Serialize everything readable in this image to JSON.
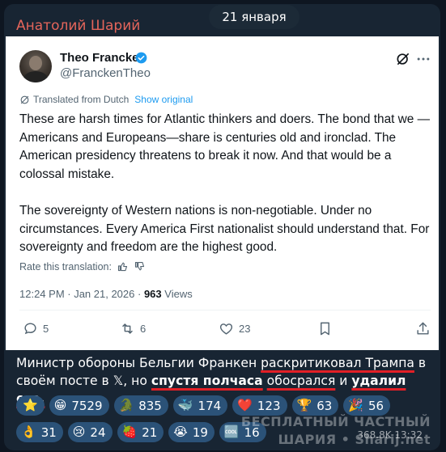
{
  "channel": {
    "sender_name": "Анатолий Шарий",
    "date": "21 января"
  },
  "tweet": {
    "author_name": "Theo Francken",
    "handle": "@FranckenTheo",
    "translated_from": "Translated from Dutch",
    "show_original": "Show original",
    "paragraphs": [
      "These are harsh times for Atlantic thinkers and doers. The bond that we —Americans and Europeans—share is centuries old and ironclad. The American presidency threatens to break it now. And that would be a colossal mistake.",
      "The sovereignty of Western nations is non-negotiable. Under no circumstances. Every America First nationalist should understand that. For sovereignty and freedom are the highest good."
    ],
    "rate_translation": "Rate this translation:",
    "time_date": "12:24 PM · Jan 21, 2026 · ",
    "views_count": "963",
    "views_label": "Views",
    "replies": "5",
    "retweets": "6",
    "likes": "23"
  },
  "caption": {
    "part1": "Министр обороны Бельгии Франкен ",
    "part2_underlined": "раскритиковал Трампа",
    "part3": " в своём посте в 𝕏, но ",
    "part4_bold_underlined": "спустя полчаса",
    "part5": " ",
    "part6_underlined": "обосрался",
    "part7": " и ",
    "part8_bold_underlined": "удалил его."
  },
  "reactions": {
    "row1": [
      {
        "emoji": "⭐",
        "count": ""
      },
      {
        "emoji": "😁",
        "count": "7529"
      },
      {
        "emoji": "🐊",
        "count": "835"
      },
      {
        "emoji": "🐳",
        "count": "174"
      },
      {
        "emoji": "❤️",
        "count": "123"
      },
      {
        "emoji": "🏆",
        "count": "63"
      },
      {
        "emoji": "🎉",
        "count": "56"
      }
    ],
    "row2": [
      {
        "emoji": "👌",
        "count": "31"
      },
      {
        "emoji": "😢",
        "count": "24"
      },
      {
        "emoji": "🍓",
        "count": "21"
      },
      {
        "emoji": "😭",
        "count": "19"
      },
      {
        "emoji": "🆒",
        "count": "16"
      }
    ]
  },
  "watermark": {
    "line1": "БЕСПЛАТНЫЙ ЧАСТНЫЙ",
    "line2": "ШАРИЯ • Sharij.net"
  },
  "message_views": "368.8K 13:32"
}
